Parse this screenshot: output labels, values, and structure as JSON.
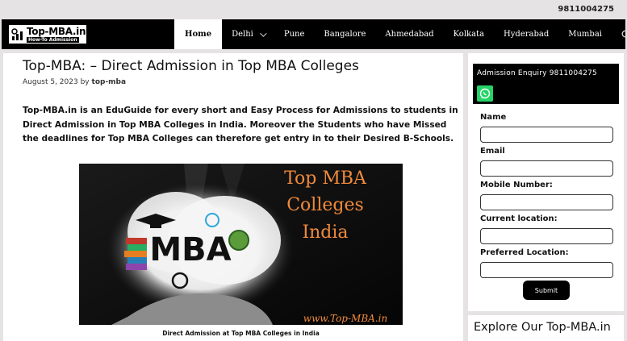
{
  "topbar": {
    "phone": "9811004275"
  },
  "logo": {
    "title": "Top-MBA.in",
    "tagline": "How-To Admission"
  },
  "nav": {
    "items": [
      {
        "label": "Home"
      },
      {
        "label": "Delhi"
      },
      {
        "label": "Pune"
      },
      {
        "label": "Bangalore"
      },
      {
        "label": "Ahmedabad"
      },
      {
        "label": "Kolkata"
      },
      {
        "label": "Hyderabad"
      },
      {
        "label": "Mumbai"
      }
    ],
    "search_icon": "search-icon",
    "dropdown_icon": "chevron-down-icon"
  },
  "article": {
    "title": "Top-MBA: – Direct Admission in Top MBA Colleges",
    "date": "August 5, 2023",
    "by": "by",
    "author": "top-mba",
    "intro": "Top-MBA.in is an EduGuide for every short and Easy Process for Admissions to students in Direct Admission in Top MBA Colleges in India. Moreover the Students who have Missed the deadlines for Top MBA Colleges can therefore get entry in to their Desired B-Schools.",
    "banner": {
      "line1": "Top MBA",
      "line2": "Colleges",
      "line3": "India",
      "center": "MBA",
      "url": "www.Top-MBA.in"
    },
    "caption": "Direct Admission at Top MBA Colleges in India"
  },
  "sidebar": {
    "enquiry": "Admission Enquiry  9811004275",
    "whatsapp_icon": "whatsapp-icon",
    "fields": [
      {
        "label": "Name"
      },
      {
        "label": "Email"
      },
      {
        "label": "Mobile Number:"
      },
      {
        "label": "Current location:"
      },
      {
        "label": "Preferred Location:"
      }
    ],
    "submit": "Submit",
    "explore": "Explore Our Top-MBA.in"
  },
  "colors": {
    "accent": "#000000",
    "whatsapp": "#25d366",
    "banner_text": "#f08a3c"
  }
}
